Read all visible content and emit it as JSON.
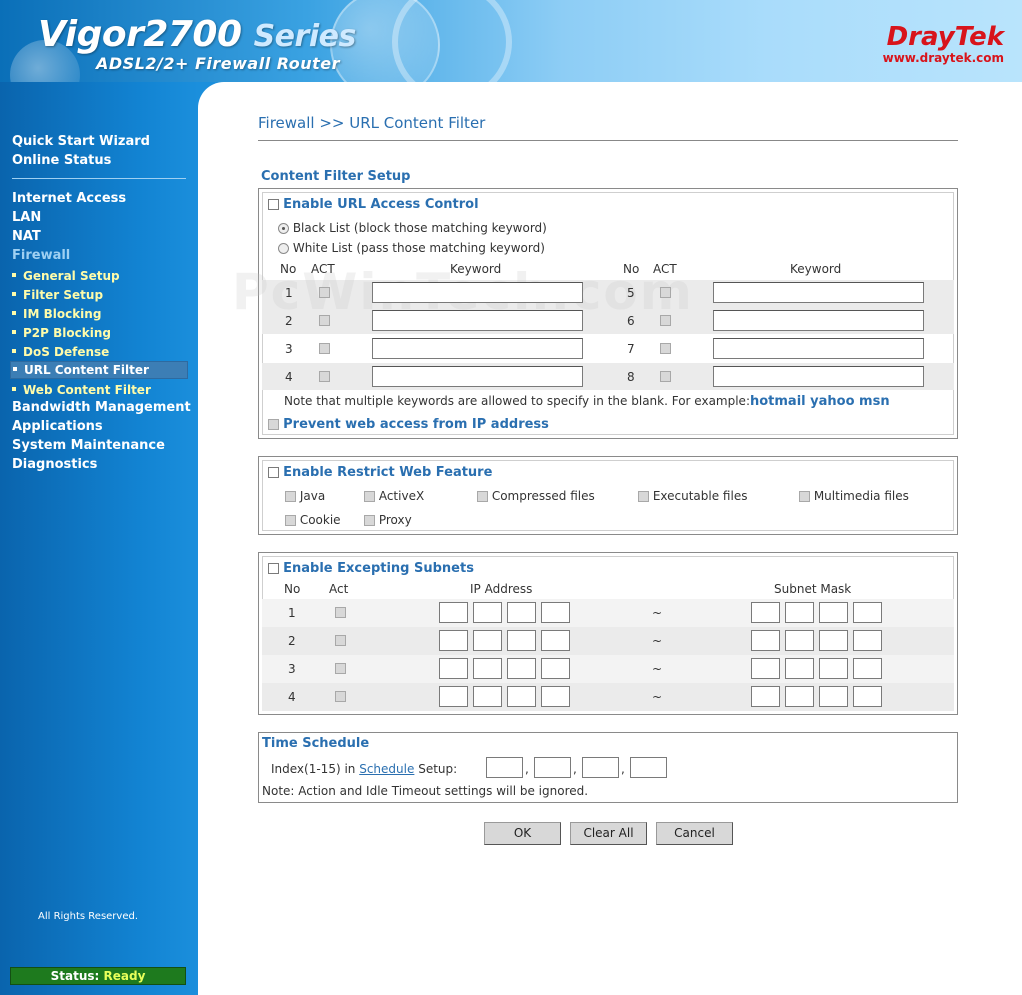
{
  "header": {
    "product_title": "Vigor2700",
    "product_series": "Series",
    "product_subtitle": "ADSL2/2+ Firewall Router",
    "brand": "DrayTek",
    "brand_url": "www.draytek.com"
  },
  "sidebar": {
    "top_items": [
      "Quick Start Wizard",
      "Online Status"
    ],
    "items": [
      "Internet Access",
      "LAN",
      "NAT",
      "Firewall"
    ],
    "firewall_sub": [
      "General Setup",
      "Filter Setup",
      "IM Blocking",
      "P2P Blocking",
      "DoS Defense",
      "URL Content Filter",
      "Web Content Filter"
    ],
    "active_sub": "URL Content Filter",
    "bottom_items": [
      "Bandwidth Management",
      "Applications",
      "System Maintenance",
      "Diagnostics"
    ],
    "rights": "All Rights Reserved.",
    "status_label": "Status:",
    "status_value": "Ready"
  },
  "page": {
    "breadcrumb": "Firewall >> URL Content Filter",
    "section_title": "Content Filter Setup",
    "watermark": "PcWinTech.com"
  },
  "url_access": {
    "enable_label": "Enable URL Access Control",
    "black_list": "Black List (block those matching keyword)",
    "white_list": "White List (pass those matching keyword)",
    "selected": "black",
    "headers": {
      "no": "No",
      "act": "ACT",
      "keyword": "Keyword"
    },
    "rows_left": [
      {
        "no": "1"
      },
      {
        "no": "2"
      },
      {
        "no": "3"
      },
      {
        "no": "4"
      }
    ],
    "rows_right": [
      {
        "no": "5"
      },
      {
        "no": "6"
      },
      {
        "no": "7"
      },
      {
        "no": "8"
      }
    ],
    "note_prefix": "Note that multiple keywords are allowed to specify in the blank. For example:",
    "note_example": "hotmail yahoo msn",
    "prevent_label": "Prevent web access from IP address"
  },
  "restrict_web": {
    "enable_label": "Enable Restrict Web Feature",
    "options": [
      "Java",
      "ActiveX",
      "Compressed files",
      "Executable files",
      "Multimedia files",
      "Cookie",
      "Proxy"
    ]
  },
  "excepting": {
    "enable_label": "Enable Excepting Subnets",
    "headers": {
      "no": "No",
      "act": "Act",
      "ip": "IP Address",
      "mask": "Subnet Mask"
    },
    "rows": [
      "1",
      "2",
      "3",
      "4"
    ],
    "tilde": "~"
  },
  "schedule": {
    "title": "Time Schedule",
    "prefix": "Index(1-15) in",
    "link": "Schedule",
    "suffix": "Setup:",
    "sep": ",",
    "note": "Note: Action and Idle Timeout settings will be ignored."
  },
  "buttons": {
    "ok": "OK",
    "clear": "Clear All",
    "cancel": "Cancel"
  }
}
